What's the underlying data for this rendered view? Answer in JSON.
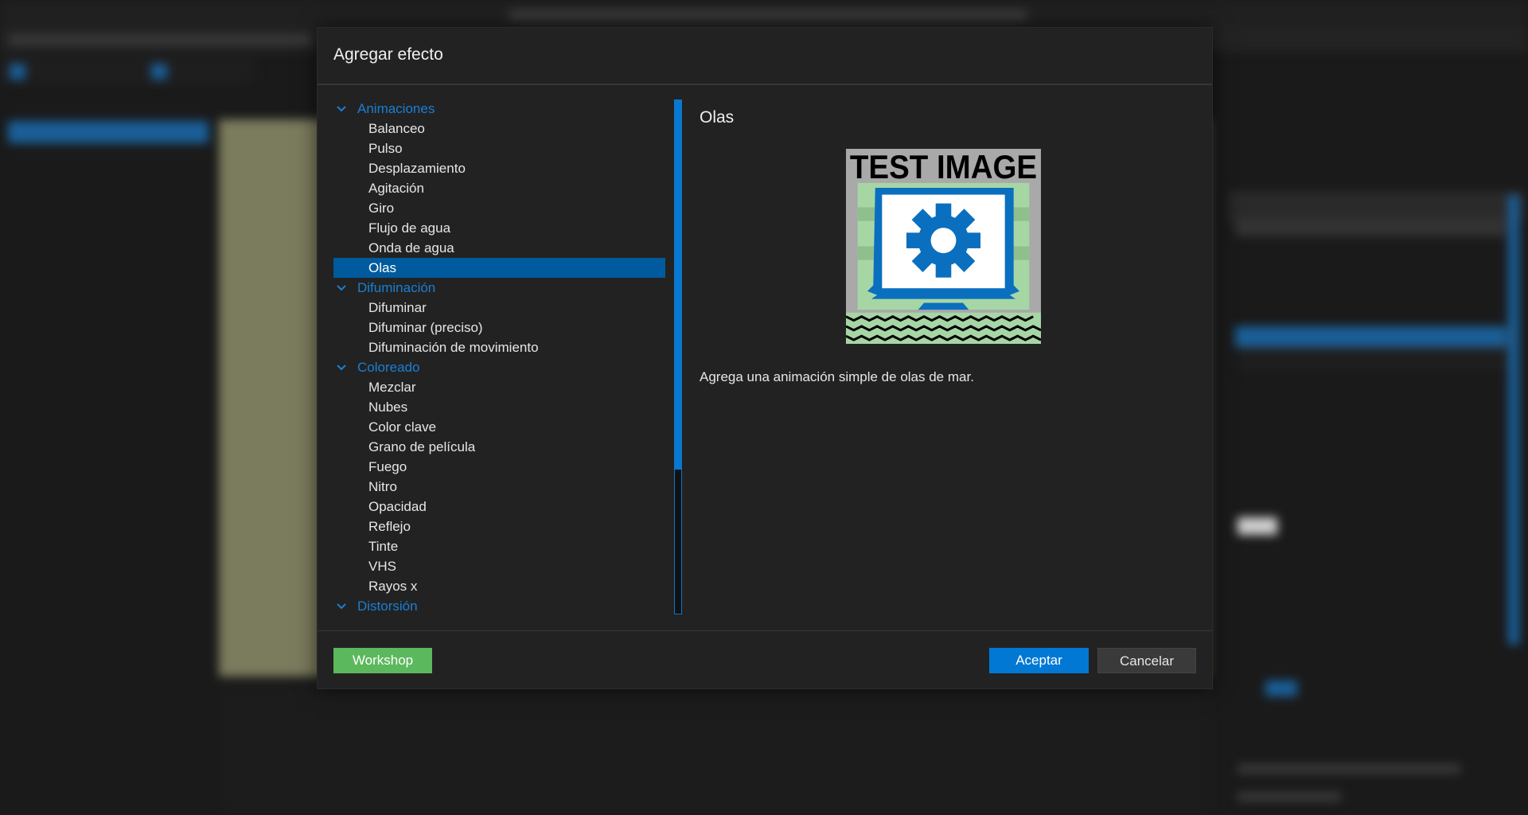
{
  "dialog": {
    "title": "Agregar efecto",
    "categories": [
      {
        "label": "Animaciones",
        "items": [
          "Balanceo",
          "Pulso",
          "Desplazamiento",
          "Agitación",
          "Giro",
          "Flujo de agua",
          "Onda de agua",
          "Olas"
        ]
      },
      {
        "label": "Difuminación",
        "items": [
          "Difuminar",
          "Difuminar (preciso)",
          "Difuminación de movimiento"
        ]
      },
      {
        "label": "Coloreado",
        "items": [
          "Mezclar",
          "Nubes",
          "Color clave",
          "Grano de película",
          "Fuego",
          "Nitro",
          "Opacidad",
          "Reflejo",
          "Tinte",
          "VHS",
          "Rayos x"
        ]
      },
      {
        "label": "Distorsión",
        "items": []
      }
    ],
    "selected": "Olas",
    "preview": {
      "title": "Olas",
      "image_text": "TEST IMAGE",
      "description": "Agrega una animación simple de olas de mar."
    },
    "buttons": {
      "workshop": "Workshop",
      "accept": "Aceptar",
      "cancel": "Cancelar"
    },
    "scroll_fraction": 0.72
  },
  "colors": {
    "accent": "#0078d4",
    "selection": "#005a9e",
    "workshop": "#5cb85c",
    "cancel": "#3a3a3a"
  }
}
